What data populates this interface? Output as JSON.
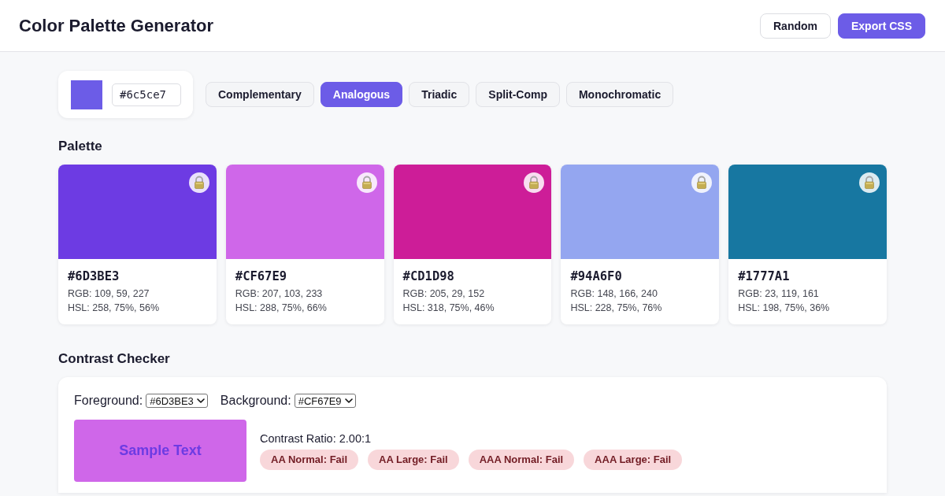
{
  "header": {
    "title": "Color Palette Generator",
    "buttons": [
      {
        "label": "Random",
        "kind": "secondary"
      },
      {
        "label": "Export CSS",
        "kind": "primary"
      }
    ]
  },
  "base_color": {
    "value": "#6c5ce7"
  },
  "harmony_tabs": [
    {
      "label": "Complementary",
      "selected": false
    },
    {
      "label": "Analogous",
      "selected": true
    },
    {
      "label": "Triadic",
      "selected": false
    },
    {
      "label": "Split-Comp",
      "selected": false
    },
    {
      "label": "Monochromatic",
      "selected": false
    }
  ],
  "palette": {
    "title": "Palette",
    "colors": [
      {
        "hex": "#6D3BE3",
        "rgb": "RGB: 109, 59, 227",
        "hsl": "HSL: 258, 75%, 56%",
        "color": "#6d3be3"
      },
      {
        "hex": "#CF67E9",
        "rgb": "RGB: 207, 103, 233",
        "hsl": "HSL: 288, 75%, 66%",
        "color": "#cf67e9"
      },
      {
        "hex": "#CD1D98",
        "rgb": "RGB: 205, 29, 152",
        "hsl": "HSL: 318, 75%, 46%",
        "color": "#cd1d98"
      },
      {
        "hex": "#94A6F0",
        "rgb": "RGB: 148, 166, 240",
        "hsl": "HSL: 228, 75%, 76%",
        "color": "#94a6f0"
      },
      {
        "hex": "#1777A1",
        "rgb": "RGB: 23, 119, 161",
        "hsl": "HSL: 198, 75%, 36%",
        "color": "#1777a1"
      }
    ]
  },
  "contrast_checker": {
    "title": "Contrast Checker",
    "foreground": {
      "label": "Foreground:",
      "value": "#6D3BE3"
    },
    "background": {
      "label": "Background:",
      "value": "#CF67E9"
    },
    "sample_text": "Sample Text",
    "ratio": "Contrast Ratio: 2.00:1",
    "results": [
      {
        "label": "AA Normal: Fail",
        "passed": false
      },
      {
        "label": "AA Large: Fail",
        "passed": false
      },
      {
        "label": "AAA Normal: Fail",
        "passed": false
      },
      {
        "label": "AAA Large: Fail",
        "passed": false
      }
    ]
  }
}
